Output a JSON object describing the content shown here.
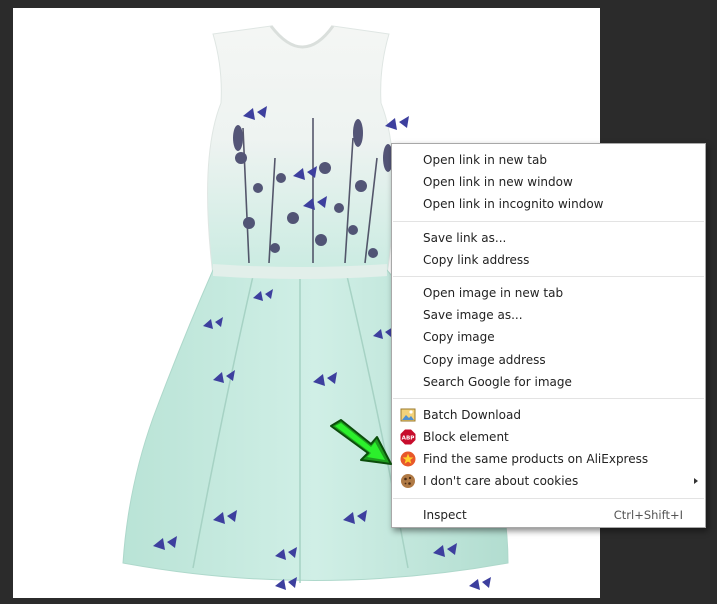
{
  "context_menu": {
    "groups": [
      [
        "Open link in new tab",
        "Open link in new window",
        "Open link in incognito window"
      ],
      [
        "Save link as...",
        "Copy link address"
      ],
      [
        "Open image in new tab",
        "Save image as...",
        "Copy image",
        "Copy image address",
        "Search Google for image"
      ]
    ],
    "extensions": [
      {
        "label": "Batch Download",
        "icon": "image-download-icon"
      },
      {
        "label": "Block element",
        "icon": "adblock-plus-icon",
        "icon_text": "ABP"
      },
      {
        "label": "Find the same products on AliExpress",
        "icon": "aliexpress-star-icon"
      },
      {
        "label": "I don't care about cookies",
        "icon": "cookie-icon",
        "has_submenu": true
      }
    ],
    "inspect": {
      "label": "Inspect",
      "shortcut": "Ctrl+Shift+I"
    }
  },
  "colors": {
    "background": "#2b2b2b",
    "annotation_arrow": "#22dd22",
    "abp_red": "#c70d2c",
    "aliexpress_orange": "#e8582a"
  }
}
